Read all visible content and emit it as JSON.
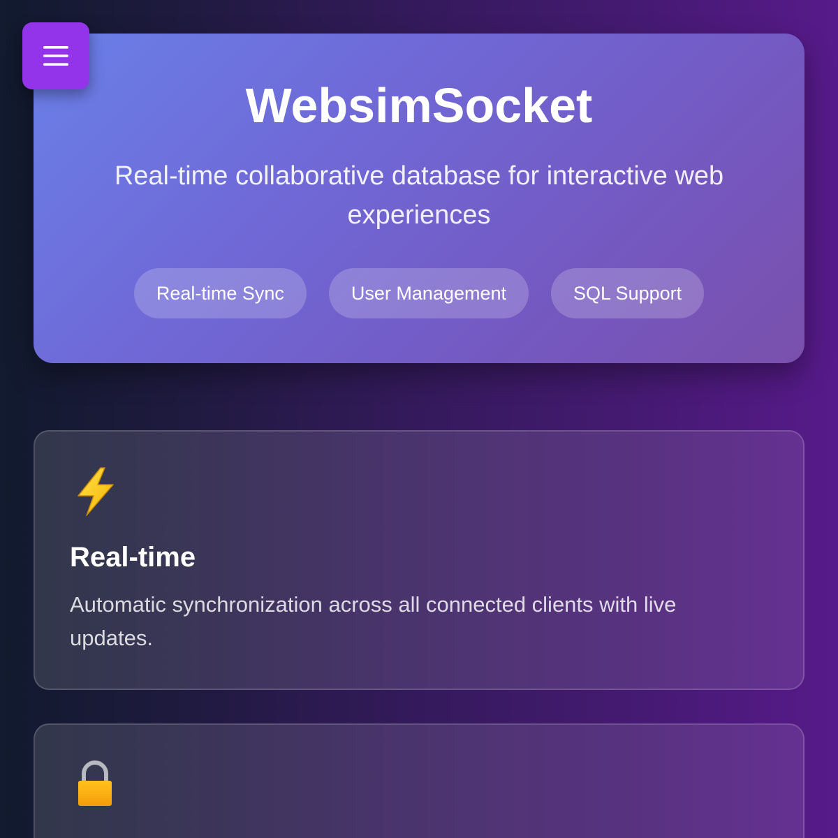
{
  "menu": {
    "icon": "hamburger-menu-icon",
    "color": "#9333ea"
  },
  "hero": {
    "title": "WebsimSocket",
    "subtitle": "Real-time collaborative database for interactive web experiences",
    "tags": [
      "Real-time Sync",
      "User Management",
      "SQL Support"
    ]
  },
  "features": [
    {
      "icon": "lightning-bolt-icon",
      "title": "Real-time",
      "description": "Automatic synchronization across all connected clients with live updates."
    },
    {
      "icon": "lock-icon"
    }
  ]
}
